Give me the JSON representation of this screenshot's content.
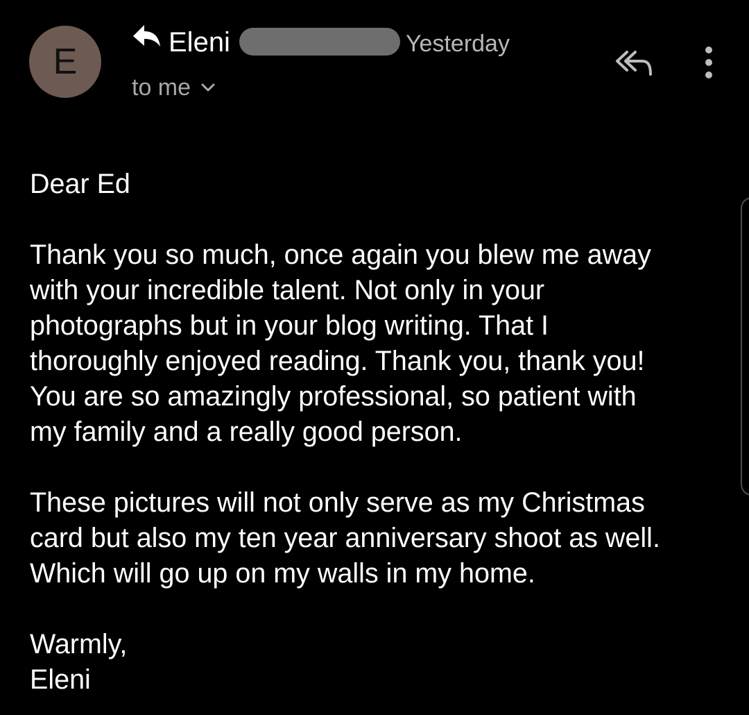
{
  "header": {
    "avatar_letter": "E",
    "sender_name": "Eleni",
    "timestamp": "Yesterday",
    "recipient_label": "to me"
  },
  "icons": {
    "reply_indicator": "reply-icon",
    "recipient_toggle": "chevron-down-icon",
    "reply_all": "reply-all-icon",
    "more_options": "more-vertical-icon"
  },
  "colors": {
    "background": "#000000",
    "text": "#ffffff",
    "avatar": "#6d5a52",
    "redaction": "#6e6e6e"
  },
  "message": {
    "greeting": "Dear Ed",
    "paragraph1": [
      "Thank you so much, once again you blew me away",
      "with your incredible talent. Not only in your",
      "photographs but in your blog writing. That I",
      "thoroughly enjoyed reading. Thank you, thank you!",
      "You are so amazingly professional, so patient with",
      "my family and a really good person."
    ],
    "paragraph2": [
      "These pictures will not only serve as my Christmas",
      "card but also my ten year anniversary shoot as well.",
      "Which will go up on my walls in my home."
    ],
    "closing": "Warmly,",
    "signature": "Eleni"
  }
}
